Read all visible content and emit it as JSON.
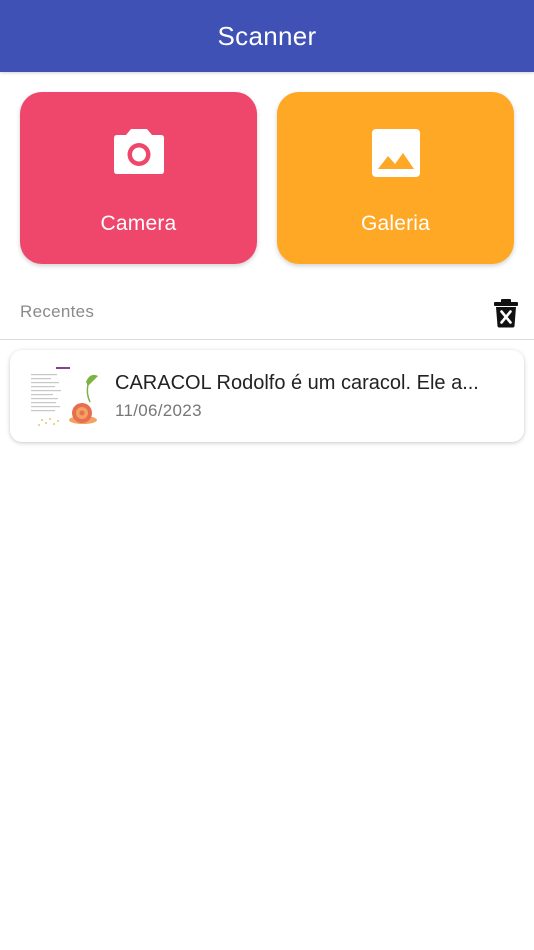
{
  "appbar": {
    "title": "Scanner",
    "color": "#3f51b5"
  },
  "actions": {
    "camera": {
      "label": "Camera",
      "icon": "camera-icon",
      "color": "#ef476b"
    },
    "gallery": {
      "label": "Galeria",
      "icon": "image-icon",
      "color": "#fea825"
    }
  },
  "recent": {
    "title": "Recentes",
    "clear_icon": "delete-forever-icon",
    "items": [
      {
        "title": "CARACOL Rodolfo é um caracol. Ele a...",
        "date": "11/06/2023",
        "thumbnail": "document-thumbnail"
      }
    ]
  }
}
